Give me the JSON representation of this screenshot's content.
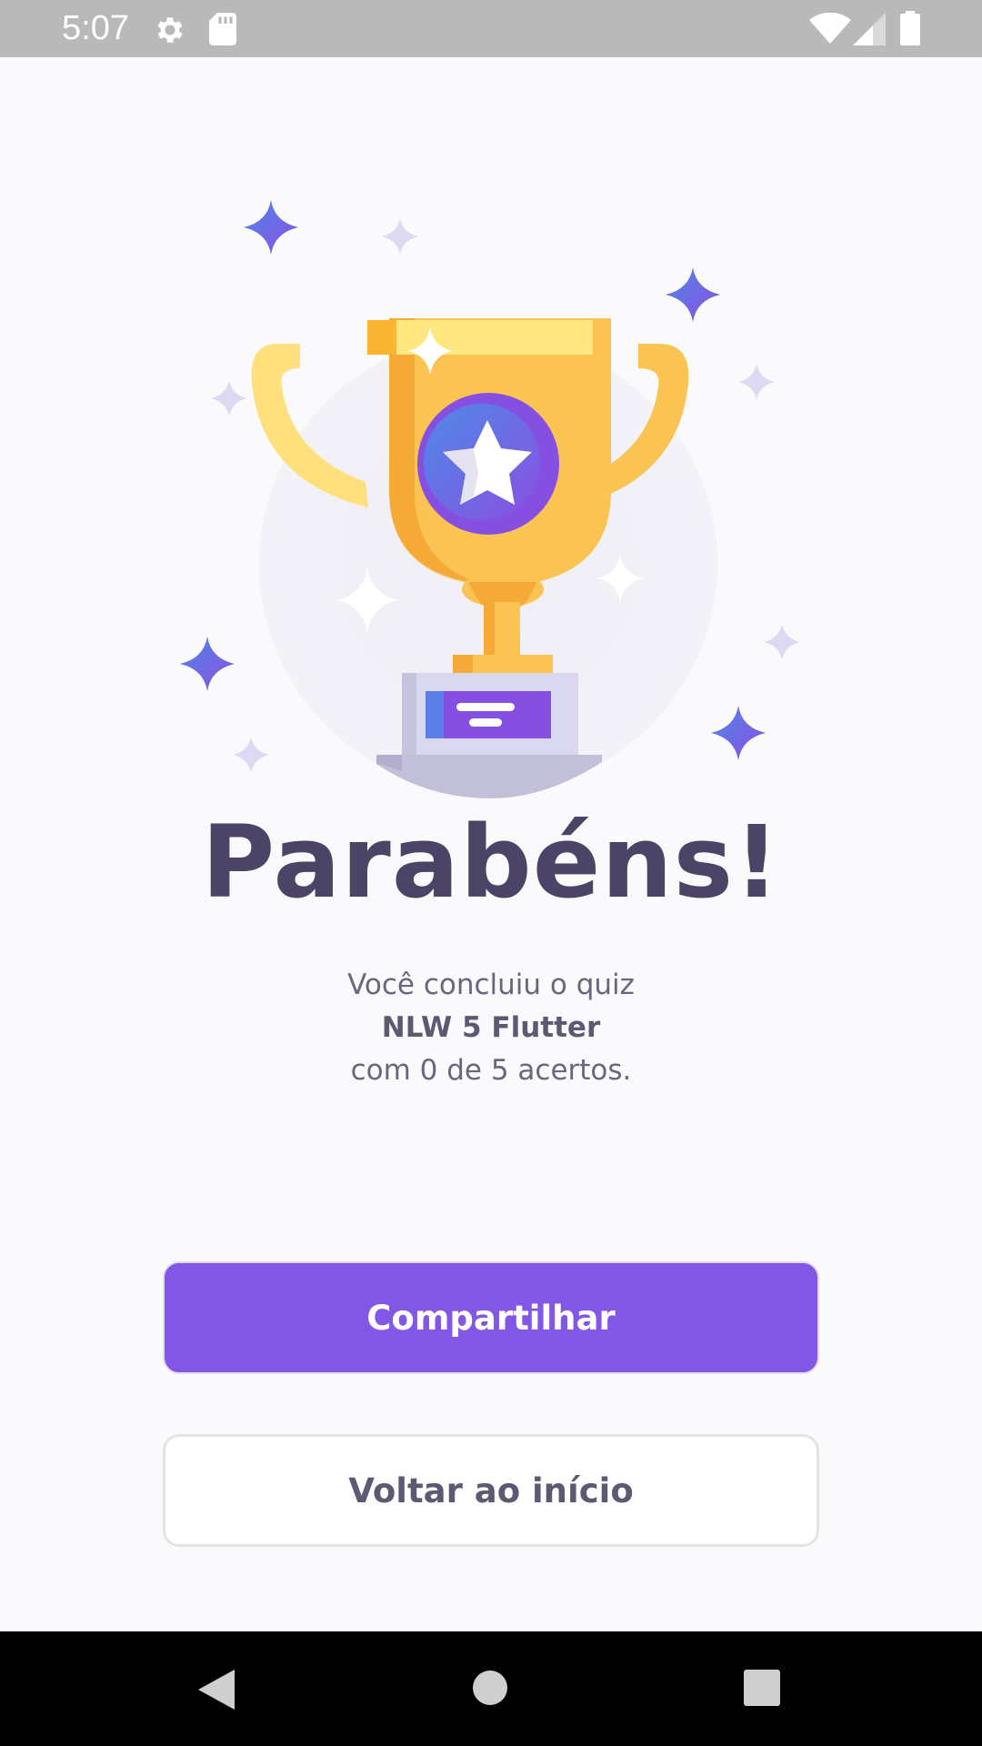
{
  "status_bar": {
    "time": "5:07",
    "icons_left": [
      "gear-icon",
      "sd-card-icon"
    ],
    "icons_right": [
      "wifi-icon",
      "signal-icon",
      "battery-icon"
    ],
    "background_color": "#B9B9B9"
  },
  "illustration": {
    "icon": "trophy-icon",
    "sparkles": "sparkle-icon"
  },
  "result": {
    "title": "Parabéns!",
    "line1": "Você concluiu o quiz",
    "quiz_name": "NLW 5 Flutter",
    "line3": "com 0 de 5 acertos."
  },
  "actions": {
    "share_label": "Compartilhar",
    "back_label": "Voltar ao início"
  },
  "nav_bar": {
    "icons": [
      "back-triangle-icon",
      "home-circle-icon",
      "recents-square-icon"
    ]
  },
  "colors": {
    "accent": "#8257E5",
    "title": "#4B4466",
    "body_text": "#6B6680",
    "trophy_gold": "#FBC351",
    "background": "#FAFAFC"
  }
}
